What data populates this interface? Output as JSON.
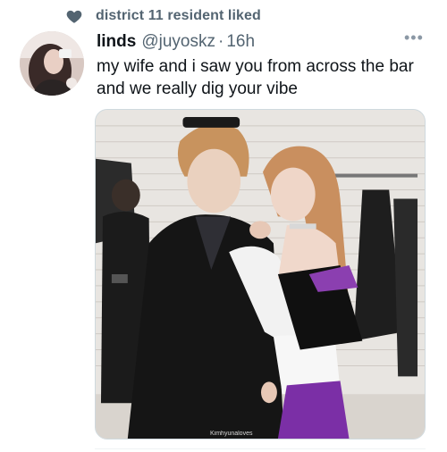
{
  "social_context": {
    "icon": "heart-icon",
    "text": "district 11 resident liked"
  },
  "tweet": {
    "display_name": "linds",
    "handle": "@juyoskz",
    "separator": "·",
    "timestamp": "16h",
    "text": "my wife and i saw you from across the bar and we really dig your vibe",
    "more_icon": "ellipsis-icon",
    "media_watermark": "Kimhyunaloves"
  },
  "colors": {
    "secondary_text": "#536471",
    "primary_text": "#0f1419",
    "border": "#cfd9de"
  }
}
